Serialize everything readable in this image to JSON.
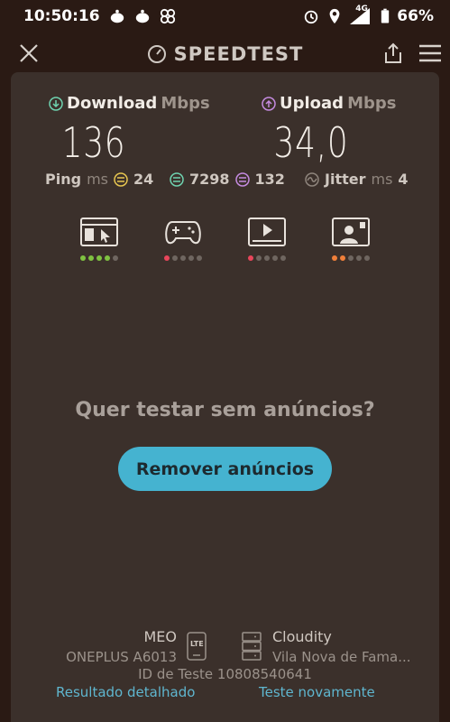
{
  "status": {
    "time": "10:50:16",
    "network": "4G",
    "battery": "66%"
  },
  "appbar": {
    "title": "SPEEDTEST"
  },
  "download": {
    "label": "Download",
    "unit": "Mbps",
    "value": "136"
  },
  "upload": {
    "label": "Upload",
    "unit": "Mbps",
    "value": "34,0"
  },
  "ping": {
    "label": "Ping",
    "unit": "ms",
    "value": "24"
  },
  "ping_download": {
    "value": "7298"
  },
  "ping_upload": {
    "value": "132"
  },
  "jitter": {
    "label": "Jitter",
    "unit": "ms",
    "value": "4"
  },
  "quality": [
    {
      "name": "browsing",
      "level": 4,
      "color": "#7fc241"
    },
    {
      "name": "gaming",
      "level": 1,
      "color": "#e8465b"
    },
    {
      "name": "streaming",
      "level": 1,
      "color": "#e8465b"
    },
    {
      "name": "video-call",
      "level": 2,
      "color": "#ef7f3a"
    }
  ],
  "promo": {
    "text": "Quer testar sem anúncios?",
    "button": "Remover anúncios"
  },
  "footer": {
    "isp": "MEO",
    "device": "ONEPLUS A6013",
    "lte_badge": "LTE",
    "server": "Cloudity",
    "location": "Vila Nova de Fama...",
    "test_id": "ID de Teste 10808540641",
    "detail_link": "Resultado detalhado",
    "retest_link": "Teste novamente"
  },
  "colors": {
    "background": "#2a1a14",
    "card": "#3b302b",
    "accent": "#45b3d0",
    "download": "#6fd3b0",
    "upload": "#c58be0"
  }
}
